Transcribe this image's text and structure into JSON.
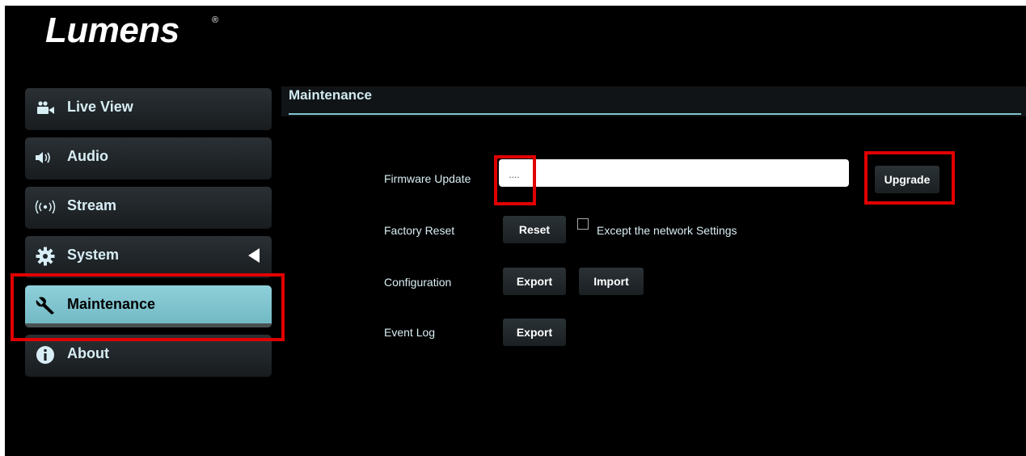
{
  "brand": {
    "name": "Lumens",
    "reg": "®"
  },
  "sidebar": {
    "items": [
      {
        "label": "Live View",
        "icon": "video-camera-icon"
      },
      {
        "label": "Audio",
        "icon": "speaker-icon"
      },
      {
        "label": "Stream",
        "icon": "broadcast-icon"
      },
      {
        "label": "System",
        "icon": "gear-icon"
      },
      {
        "label": "Maintenance",
        "icon": "wrench-icon"
      },
      {
        "label": "About",
        "icon": "info-icon"
      }
    ],
    "active": "Maintenance"
  },
  "page": {
    "title": "Maintenance"
  },
  "form": {
    "firmware": {
      "label": "Firmware Update",
      "browse_label": "....",
      "value": "",
      "upgrade_label": "Upgrade"
    },
    "factory": {
      "label": "Factory Reset",
      "reset_label": "Reset",
      "checkbox_label": "Except the network Settings",
      "checked": false
    },
    "config": {
      "label": "Configuration",
      "export_label": "Export",
      "import_label": "Import"
    },
    "eventlog": {
      "label": "Event Log",
      "export_label": "Export"
    }
  },
  "colors": {
    "accent": "#7fc3cf",
    "active_nav": "#8fd0da",
    "highlight": "#e00000",
    "background": "#000000"
  }
}
